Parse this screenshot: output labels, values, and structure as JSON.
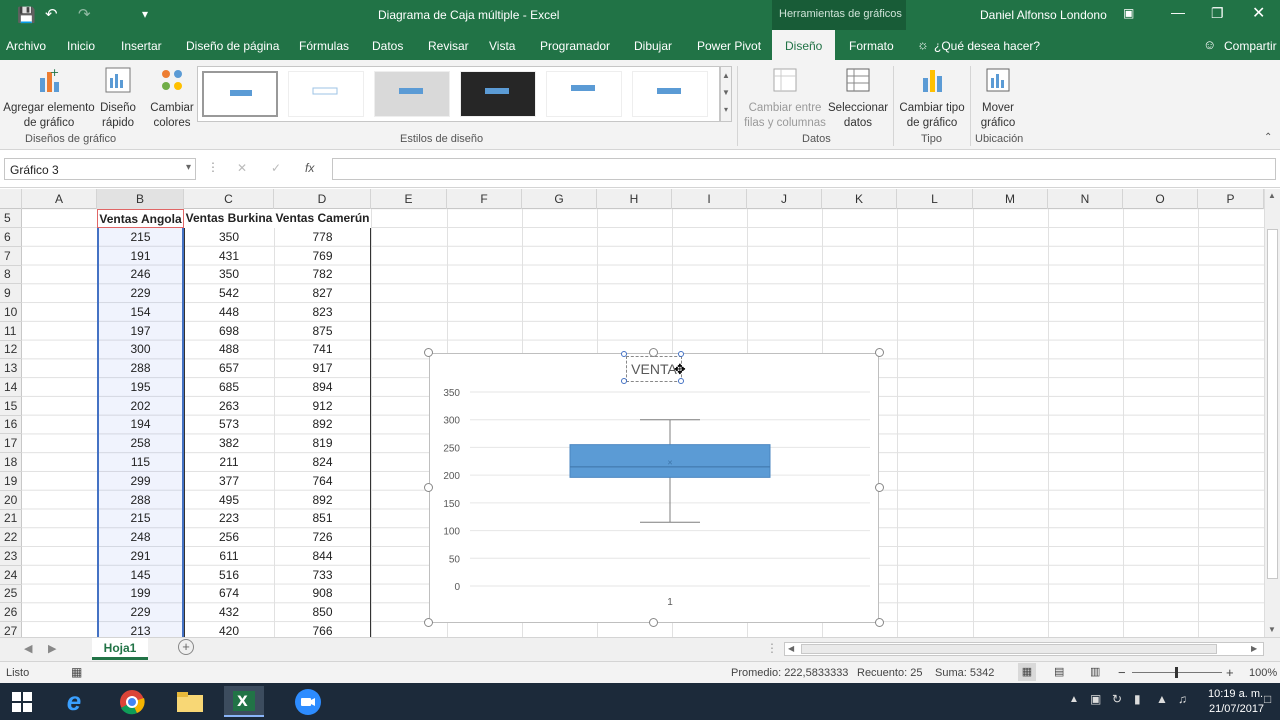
{
  "titlebar": {
    "title": "Diagrama de Caja múltiple  -  Excel",
    "context_tools": "Herramientas de gráficos",
    "user": "Daniel Alfonso Londono"
  },
  "menu": {
    "tabs": [
      "Archivo",
      "Inicio",
      "Insertar",
      "Diseño de página",
      "Fórmulas",
      "Datos",
      "Revisar",
      "Vista",
      "Programador",
      "Dibujar",
      "Power Pivot",
      "Diseño",
      "Formato"
    ],
    "active_tab": "Diseño",
    "tell_me": "¿Qué desea hacer?",
    "share": "Compartir"
  },
  "ribbon": {
    "add_element": "Agregar elemento de gráfico",
    "quick_layout": "Diseño rápido",
    "change_colors": "Cambiar colores",
    "group_layouts": "Diseños de gráfico",
    "group_styles": "Estilos de diseño",
    "switch_rowcol": "Cambiar entre filas y columnas",
    "select_data": "Seleccionar datos",
    "group_data": "Datos",
    "change_type": "Cambiar tipo de gráfico",
    "group_type": "Tipo",
    "move_chart": "Mover gráfico",
    "group_location": "Ubicación"
  },
  "formula_bar": {
    "name_box": "Gráfico 3",
    "fx": "fx",
    "formula": ""
  },
  "columns": [
    "A",
    "B",
    "C",
    "D",
    "E",
    "F",
    "G",
    "H",
    "I",
    "J",
    "K",
    "L",
    "M",
    "N",
    "O",
    "P"
  ],
  "table": {
    "headers": [
      "Ventas Angola",
      "Ventas Burkina",
      "Ventas Camerún"
    ],
    "rows": [
      {
        "n": "6",
        "b": "215",
        "c": "350",
        "d": "778"
      },
      {
        "n": "7",
        "b": "191",
        "c": "431",
        "d": "769"
      },
      {
        "n": "8",
        "b": "246",
        "c": "350",
        "d": "782"
      },
      {
        "n": "9",
        "b": "229",
        "c": "542",
        "d": "827"
      },
      {
        "n": "10",
        "b": "154",
        "c": "448",
        "d": "823"
      },
      {
        "n": "11",
        "b": "197",
        "c": "698",
        "d": "875"
      },
      {
        "n": "12",
        "b": "300",
        "c": "488",
        "d": "741"
      },
      {
        "n": "13",
        "b": "288",
        "c": "657",
        "d": "917"
      },
      {
        "n": "14",
        "b": "195",
        "c": "685",
        "d": "894"
      },
      {
        "n": "15",
        "b": "202",
        "c": "263",
        "d": "912"
      },
      {
        "n": "16",
        "b": "194",
        "c": "573",
        "d": "892"
      },
      {
        "n": "17",
        "b": "258",
        "c": "382",
        "d": "819"
      },
      {
        "n": "18",
        "b": "115",
        "c": "211",
        "d": "824"
      },
      {
        "n": "19",
        "b": "299",
        "c": "377",
        "d": "764"
      },
      {
        "n": "20",
        "b": "288",
        "c": "495",
        "d": "892"
      },
      {
        "n": "21",
        "b": "215",
        "c": "223",
        "d": "851"
      },
      {
        "n": "22",
        "b": "248",
        "c": "256",
        "d": "726"
      },
      {
        "n": "23",
        "b": "291",
        "c": "611",
        "d": "844"
      },
      {
        "n": "24",
        "b": "145",
        "c": "516",
        "d": "733"
      },
      {
        "n": "25",
        "b": "199",
        "c": "674",
        "d": "908"
      },
      {
        "n": "26",
        "b": "229",
        "c": "432",
        "d": "850"
      },
      {
        "n": "27",
        "b": "213",
        "c": "420",
        "d": "766"
      }
    ],
    "header_row": "5"
  },
  "chart_data": {
    "type": "box",
    "title": "VENTA",
    "categories": [
      "1"
    ],
    "yticks": [
      "350",
      "300",
      "250",
      "200",
      "150",
      "100",
      "50",
      "0"
    ],
    "ylim": [
      0,
      350
    ],
    "box": {
      "min": 115,
      "q1": 196,
      "median": 215,
      "q3": 255,
      "max": 300,
      "mean": 223
    },
    "grid": true,
    "color": "#5b9bd5"
  },
  "sheet": {
    "tab": "Hoja1"
  },
  "status": {
    "ready": "Listo",
    "average": "Promedio: 222,5833333",
    "count": "Recuento: 25",
    "sum": "Suma: 5342",
    "zoom": "100%"
  },
  "taskbar": {
    "time": "10:19 a. m.",
    "date": "21/07/2017"
  },
  "colors": {
    "excel_green": "#217346",
    "taskbar": "#1c2a3a"
  }
}
